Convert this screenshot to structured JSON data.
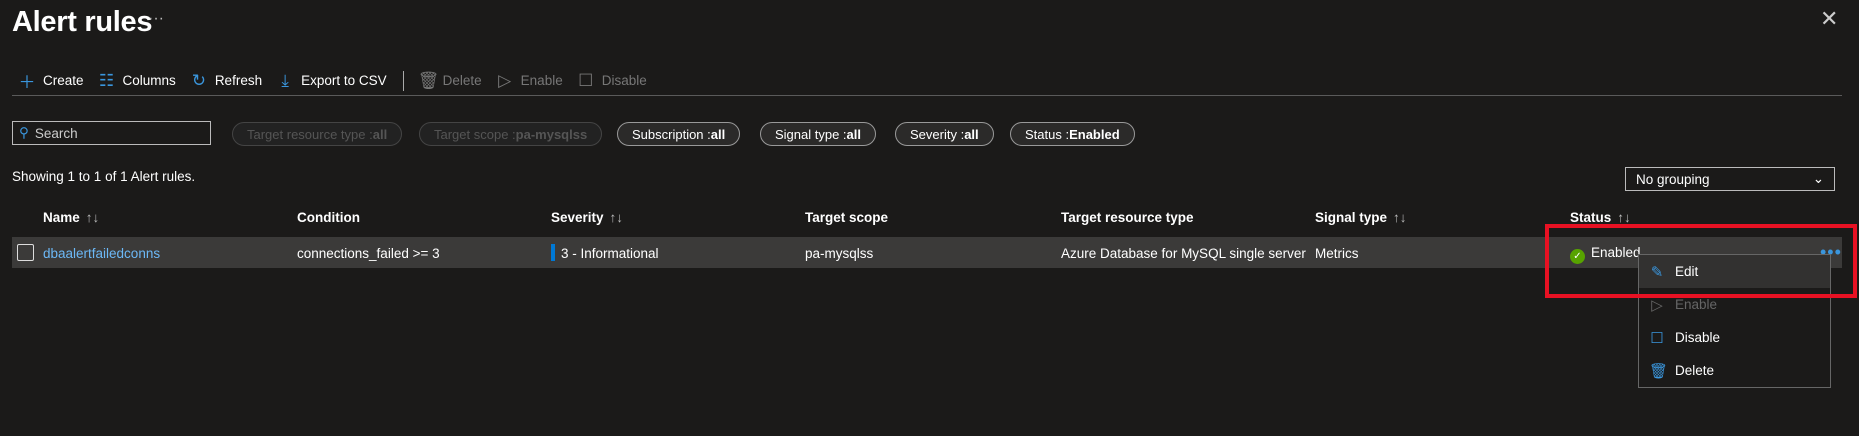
{
  "header": {
    "title": "Alert rules",
    "more": "···",
    "close": "✕"
  },
  "toolbar": {
    "create": "Create",
    "columns": "Columns",
    "refresh": "Refresh",
    "export": "Export to CSV",
    "delete": "Delete",
    "enable": "Enable",
    "disable": "Disable"
  },
  "search": {
    "placeholder": "Search"
  },
  "filters": [
    {
      "label": "Target resource type : ",
      "value": "all"
    },
    {
      "label": "Target scope : ",
      "value": "pa-mysqlss"
    },
    {
      "label": "Subscription : ",
      "value": "all"
    },
    {
      "label": "Signal type : ",
      "value": "all"
    },
    {
      "label": "Severity : ",
      "value": "all"
    },
    {
      "label": "Status : ",
      "value": "Enabled"
    }
  ],
  "showing": "Showing 1 to 1 of 1 Alert rules.",
  "grouping": {
    "selected": "No grouping"
  },
  "columns": [
    "Name",
    "Condition",
    "Severity",
    "Target scope",
    "Target resource type",
    "Signal type",
    "Status"
  ],
  "sort_icon": "↑↓",
  "rows": [
    {
      "name": "dbaalertfailedconns",
      "condition": "connections_failed >= 3",
      "severity": "3 - Informational",
      "target_scope": "pa-mysqlss",
      "target_resource_type": "Azure Database for MySQL single server",
      "signal_type": "Metrics",
      "status": "Enabled"
    }
  ],
  "context_menu": {
    "edit": "Edit",
    "enable": "Enable",
    "disable": "Disable",
    "delete": "Delete"
  },
  "colors": {
    "accent": "#3a96dd",
    "highlight": "#e81123",
    "enabled": "#57a300"
  }
}
